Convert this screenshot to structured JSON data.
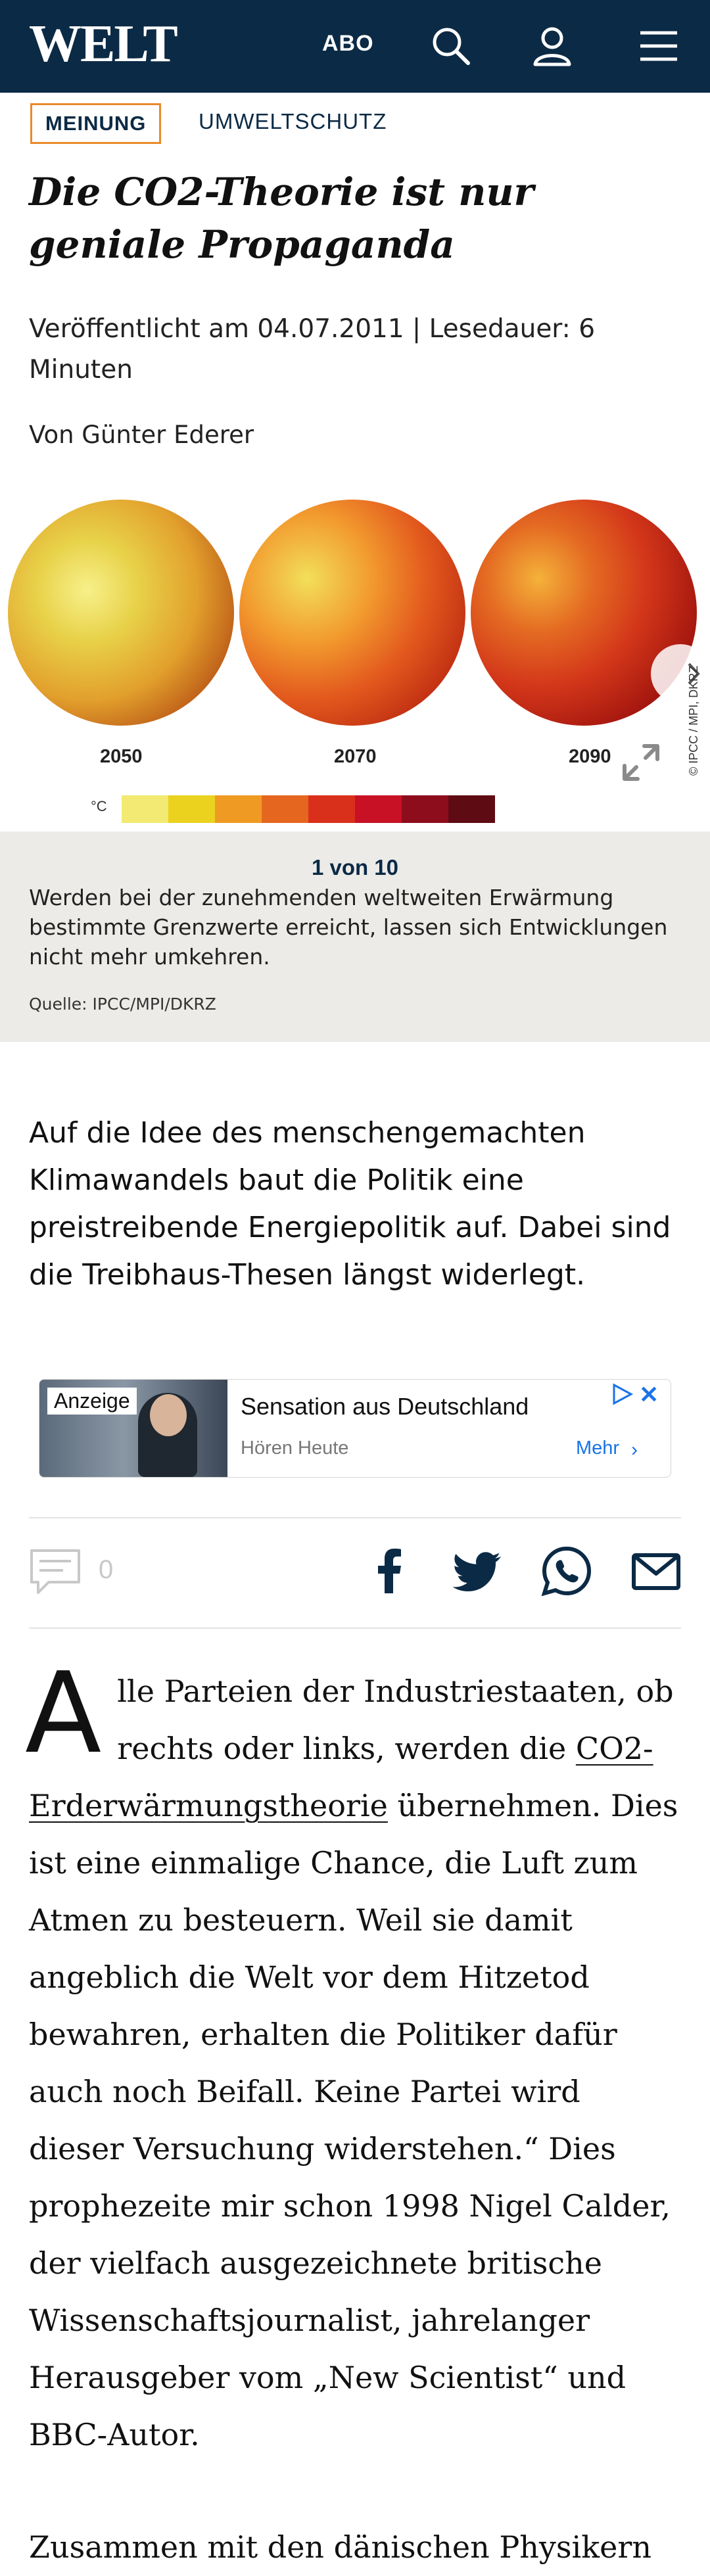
{
  "header": {
    "logo": "WELT",
    "abo_label": "ABO",
    "icons": [
      "search-icon",
      "account-icon",
      "menu-icon"
    ],
    "bg_color": "#0b2a45"
  },
  "article": {
    "kicker": "MEINUNG",
    "topic": "UMWELTSCHUTZ",
    "headline": "Die CO2-Theorie ist nur geniale Propaganda",
    "published": "Veröffentlicht am 04.07.2011 | Lesedauer: 6 Minuten",
    "author": "Von Günter Ederer",
    "intro": "Auf die Idee des menschengemachten Klimawandels baut die Politik eine preistreibende Energiepolitik auf. Dabei sind die Treibhaus-Thesen längst widerlegt.",
    "dropcap": "A",
    "paragraph1_a": "lle Parteien der Industriestaaten, ob rechts oder links, werden die ",
    "paragraph1_link": "CO2-Erderwärmungstheorie",
    "paragraph1_b": " übernehmen. Dies ist eine einmalige Chance, die Luft zum Atmen zu besteuern. Weil sie damit angeblich die Welt vor dem Hitzetod bewahren, erhalten die Politiker dafür auch noch Beifall. Keine Partei wird dieser Versuchung widerstehen.“ Dies prophezeite mir schon 1998 Nigel Calder, der vielfach ausgezeichnete britische Wissenschaftsjournalist, jahrelanger Herausgeber vom „New Scientist“ und BBC-Autor.",
    "paragraph2": "Zusammen mit den dänischen Physikern"
  },
  "gallery": {
    "years": [
      "2050",
      "2070",
      "2090"
    ],
    "unit_label": "°C",
    "scale_colors": [
      "#f2ea72",
      "#ead21f",
      "#ef9b23",
      "#e5661f",
      "#d9301c",
      "#c81125",
      "#8e0d1d",
      "#5e0b14"
    ],
    "image_credit": "© IPCC / MPI, DKRZ",
    "counter": "1 von 10",
    "caption": "Werden bei der zunehmenden weltweiten Erwärmung bestimmte Grenzwerte erreicht, lassen sich Entwicklungen nicht mehr umkehren.",
    "source": "Quelle: IPCC/MPI/DKRZ"
  },
  "ad": {
    "label": "Anzeige",
    "title": "Sensation aus Deutschland",
    "subtitle": "Hören Heute",
    "more": "Mehr",
    "chevron": "›",
    "close": "✕"
  },
  "social": {
    "comment_count": "0",
    "share_icons": [
      "facebook-icon",
      "twitter-icon",
      "whatsapp-icon",
      "email-icon"
    ]
  }
}
